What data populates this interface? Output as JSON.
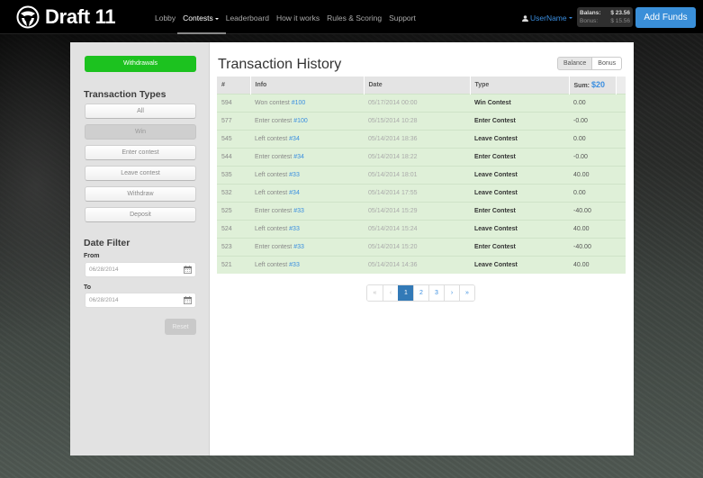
{
  "brand": {
    "name": "Draft 11",
    "logo_icon": "soccer-ball-icon"
  },
  "nav": {
    "items": [
      {
        "label": "Lobby",
        "active": false
      },
      {
        "label": "Contests",
        "active": true,
        "dropdown": true
      },
      {
        "label": "Leaderboard",
        "active": false
      },
      {
        "label": "How it works",
        "active": false
      },
      {
        "label": "Rules & Scoring",
        "active": false
      },
      {
        "label": "Support",
        "active": false
      }
    ]
  },
  "user": {
    "name": "UserName",
    "icon": "user-icon",
    "balance_label": "Balans:",
    "balance_value": "$ 23.56",
    "bonus_label": "Bonus:",
    "bonus_value": "$ 15.56",
    "add_funds_label": "Add Funds"
  },
  "sidebar": {
    "withdrawals_label": "Withdrawals",
    "types_heading": "Transaction Types",
    "types": [
      {
        "label": "All",
        "selected": false
      },
      {
        "label": "Win",
        "selected": true
      },
      {
        "label": "Enter contest",
        "selected": false
      },
      {
        "label": "Leave contest",
        "selected": false
      },
      {
        "label": "Withdraw",
        "selected": false
      },
      {
        "label": "Deposit",
        "selected": false
      }
    ],
    "date_heading": "Date Filter",
    "from_label": "From",
    "from_value": "06/28/2014",
    "to_label": "To",
    "to_value": "06/28/2014",
    "reset_label": "Reset"
  },
  "main": {
    "title": "Transaction History",
    "toggle": {
      "balance_label": "Balance",
      "bonus_label": "Bonus",
      "active": "Balance"
    },
    "columns": {
      "id": "#",
      "info": "Info",
      "date": "Date",
      "type": "Type",
      "sum": "Sum:",
      "sum_total": "$20"
    },
    "rows": [
      {
        "id": "594",
        "info": "Won contest",
        "link": "#100",
        "date": "05/17/2014 00:00",
        "type": "Win Contest",
        "sum": "0.00"
      },
      {
        "id": "577",
        "info": "Enter contest",
        "link": "#100",
        "date": "05/15/2014 10:28",
        "type": "Enter Contest",
        "sum": "-0.00"
      },
      {
        "id": "545",
        "info": "Left contest",
        "link": "#34",
        "date": "05/14/2014 18:36",
        "type": "Leave Contest",
        "sum": "0.00"
      },
      {
        "id": "544",
        "info": "Enter contest",
        "link": "#34",
        "date": "05/14/2014 18:22",
        "type": "Enter Contest",
        "sum": "-0.00"
      },
      {
        "id": "535",
        "info": "Left contest",
        "link": "#33",
        "date": "05/14/2014 18:01",
        "type": "Leave Contest",
        "sum": "40.00"
      },
      {
        "id": "532",
        "info": "Left contest",
        "link": "#34",
        "date": "05/14/2014 17:55",
        "type": "Leave Contest",
        "sum": "0.00"
      },
      {
        "id": "525",
        "info": "Enter contest",
        "link": "#33",
        "date": "05/14/2014 15:29",
        "type": "Enter Contest",
        "sum": "-40.00"
      },
      {
        "id": "524",
        "info": "Left contest",
        "link": "#33",
        "date": "05/14/2014 15:24",
        "type": "Leave Contest",
        "sum": "40.00"
      },
      {
        "id": "523",
        "info": "Enter contest",
        "link": "#33",
        "date": "05/14/2014 15:20",
        "type": "Enter Contest",
        "sum": "-40.00"
      },
      {
        "id": "521",
        "info": "Left contest",
        "link": "#33",
        "date": "05/14/2014 14:36",
        "type": "Leave Contest",
        "sum": "40.00"
      }
    ],
    "pagination": {
      "first": "«",
      "prev": "‹",
      "pages": [
        "1",
        "2",
        "3"
      ],
      "current": "1",
      "next": "›",
      "last": "»"
    }
  },
  "colors": {
    "accent": "#3a8ee0",
    "success": "#1cc21f",
    "row_success": "#dff0d8",
    "page_active": "#337ab7"
  }
}
